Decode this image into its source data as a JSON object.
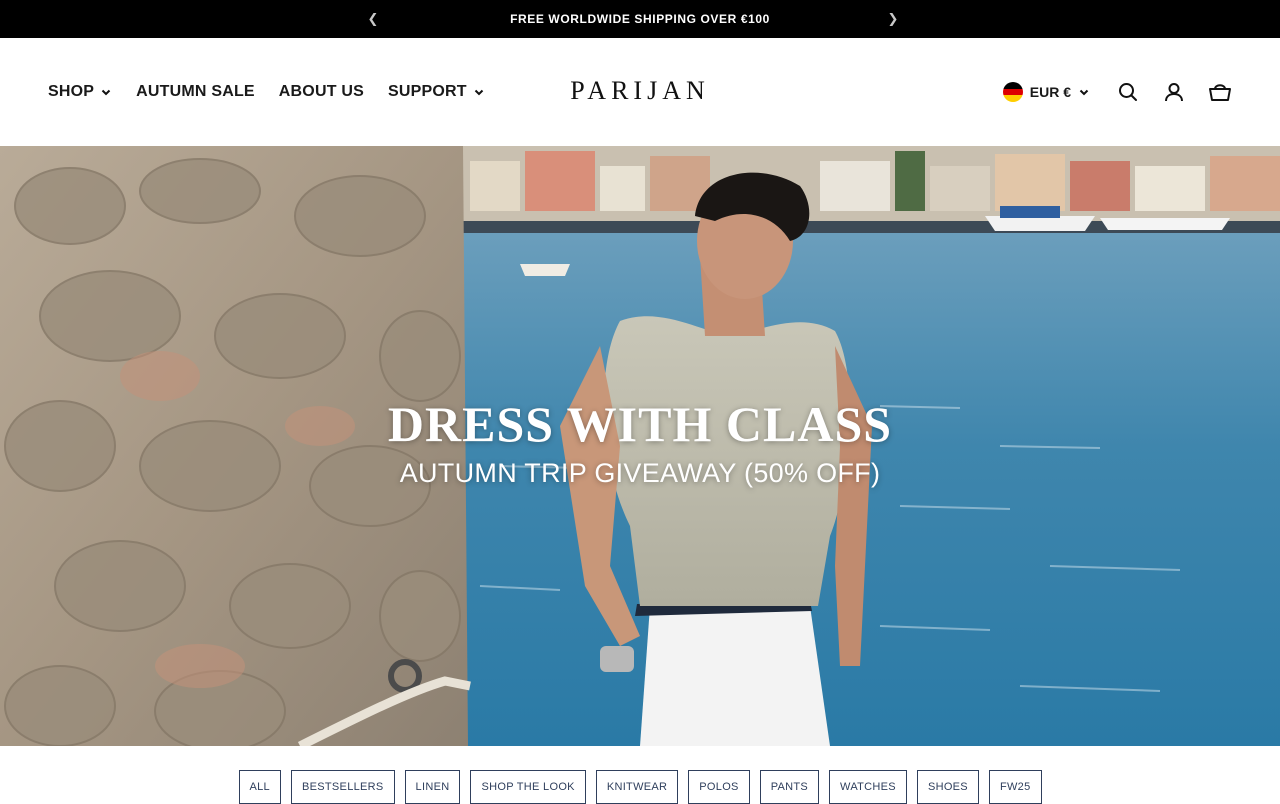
{
  "announcement": {
    "text": "FREE WORLDWIDE SHIPPING OVER €100",
    "prev_icon": "chevron-left-icon",
    "next_icon": "chevron-right-icon"
  },
  "nav": {
    "items": [
      {
        "label": "SHOP",
        "has_dropdown": true
      },
      {
        "label": "AUTUMN SALE",
        "has_dropdown": false
      },
      {
        "label": "ABOUT US",
        "has_dropdown": false
      },
      {
        "label": "SUPPORT",
        "has_dropdown": true
      }
    ]
  },
  "brand": {
    "logo": "PARIJAN"
  },
  "tools": {
    "currency": "EUR €",
    "flag_icon": "germany-flag-icon",
    "search_icon": "search-icon",
    "account_icon": "user-icon",
    "cart_icon": "basket-icon"
  },
  "hero": {
    "title": "DRESS WITH CLASS",
    "subtitle": "AUTUMN TRIP GIVEAWAY (50% OFF)"
  },
  "categories": [
    "ALL",
    "BESTSELLERS",
    "LINEN",
    "SHOP THE LOOK",
    "KNITWEAR",
    "POLOS",
    "PANTS",
    "WATCHES",
    "SHOES",
    "FW25"
  ],
  "colors": {
    "announcement_bg": "#000000",
    "accent_text": "#2f3f5c"
  }
}
